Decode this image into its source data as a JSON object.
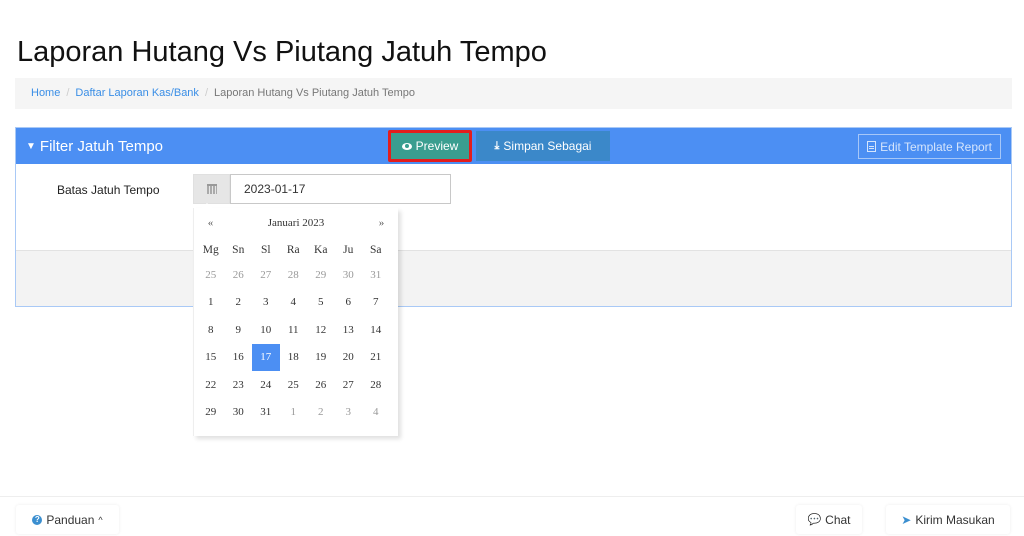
{
  "page": {
    "title": "Laporan Hutang Vs Piutang Jatuh Tempo"
  },
  "breadcrumb": {
    "items": [
      {
        "label": "Home",
        "link": true
      },
      {
        "label": "Daftar Laporan Kas/Bank",
        "link": true
      },
      {
        "label": "Laporan Hutang Vs Piutang Jatuh Tempo",
        "link": false
      }
    ],
    "separator": "/"
  },
  "panel": {
    "heading": "Filter Jatuh Tempo",
    "heading_icon": "filter-icon",
    "edit_template_label": "Edit Template Report",
    "edit_template_icon": "document-icon",
    "accent_color": "#4c8ff3"
  },
  "form": {
    "due_date_label": "Batas Jatuh Tempo",
    "due_date_value": "2023-01-17",
    "addon_icon": "calendar-icon"
  },
  "actions": {
    "preview_label": "Preview",
    "preview_icon": "eye-icon",
    "save_as_label": "Simpan Sebagai",
    "save_as_icon": "download-icon",
    "highlight_color": "#e31d1d"
  },
  "datepicker": {
    "prev": "«",
    "next": "»",
    "month_title": "Januari 2023",
    "weekdays": [
      "Mg",
      "Sn",
      "Sl",
      "Ra",
      "Ka",
      "Ju",
      "Sa"
    ],
    "weeks": [
      [
        {
          "d": "25",
          "old": true
        },
        {
          "d": "26",
          "old": true
        },
        {
          "d": "27",
          "old": true
        },
        {
          "d": "28",
          "old": true
        },
        {
          "d": "29",
          "old": true
        },
        {
          "d": "30",
          "old": true
        },
        {
          "d": "31",
          "old": true
        }
      ],
      [
        {
          "d": "1"
        },
        {
          "d": "2"
        },
        {
          "d": "3"
        },
        {
          "d": "4"
        },
        {
          "d": "5"
        },
        {
          "d": "6"
        },
        {
          "d": "7"
        }
      ],
      [
        {
          "d": "8"
        },
        {
          "d": "9"
        },
        {
          "d": "10"
        },
        {
          "d": "11"
        },
        {
          "d": "12"
        },
        {
          "d": "13"
        },
        {
          "d": "14"
        }
      ],
      [
        {
          "d": "15"
        },
        {
          "d": "16"
        },
        {
          "d": "17",
          "active": true
        },
        {
          "d": "18"
        },
        {
          "d": "19"
        },
        {
          "d": "20"
        },
        {
          "d": "21"
        }
      ],
      [
        {
          "d": "22"
        },
        {
          "d": "23"
        },
        {
          "d": "24"
        },
        {
          "d": "25"
        },
        {
          "d": "26"
        },
        {
          "d": "27"
        },
        {
          "d": "28"
        }
      ],
      [
        {
          "d": "29"
        },
        {
          "d": "30"
        },
        {
          "d": "31"
        },
        {
          "d": "1",
          "old": true
        },
        {
          "d": "2",
          "old": true
        },
        {
          "d": "3",
          "old": true
        },
        {
          "d": "4",
          "old": true
        }
      ]
    ],
    "selected": "17"
  },
  "bottom": {
    "guide_label": "Panduan",
    "guide_icon": "question-circle-icon",
    "chat_label": "Chat",
    "chat_icon": "chat-bubble-icon",
    "feedback_label": "Kirim Masukan",
    "feedback_icon": "paper-plane-icon"
  }
}
